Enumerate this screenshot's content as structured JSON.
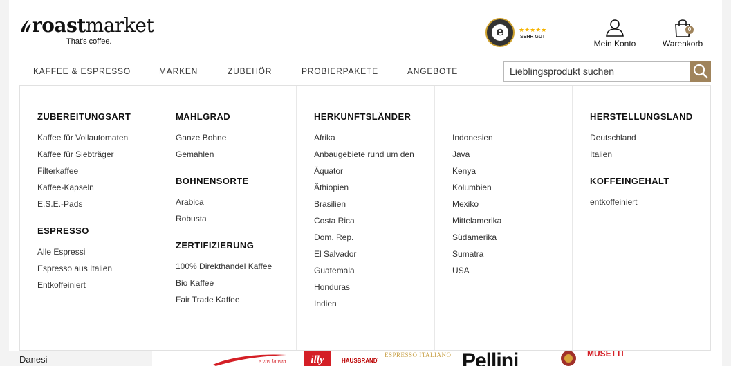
{
  "header": {
    "logo_bold": "roast",
    "logo_light": "market",
    "tagline": "That's coffee.",
    "trust_badge": {
      "stars": "★★★★★",
      "rating": "SEHR GUT",
      "seal_letter": "e",
      "icon": "trusted-shops-seal-icon"
    },
    "account_label": "Mein Konto",
    "account_icon": "user-icon",
    "cart_label": "Warenkorb",
    "cart_icon": "shopping-bag-icon",
    "cart_count": "0"
  },
  "nav": {
    "items": [
      "KAFFEE & ESPRESSO",
      "MARKEN",
      "ZUBEHÖR",
      "PROBIERPAKETE",
      "ANGEBOTE"
    ],
    "search_placeholder": "Lieblingsprodukt suchen",
    "search_icon": "search-icon"
  },
  "menu": {
    "columns": [
      {
        "sections": [
          {
            "title": "ZUBEREITUNGSART",
            "items": [
              "Kaffee für Vollautomaten",
              "Kaffee für Siebträger",
              "Filterkaffee",
              "Kaffee-Kapseln",
              "E.S.E.-Pads"
            ]
          },
          {
            "title": "ESPRESSO",
            "items": [
              "Alle Espressi",
              "Espresso aus Italien",
              "Entkoffeiniert"
            ]
          }
        ]
      },
      {
        "sections": [
          {
            "title": "MAHLGRAD",
            "items": [
              "Ganze Bohne",
              "Gemahlen"
            ]
          },
          {
            "title": "BOHNENSORTE",
            "items": [
              "Arabica",
              "Robusta"
            ]
          },
          {
            "title": "ZERTIFIZIERUNG",
            "items": [
              "100% Direkthandel Kaffee",
              "Bio Kaffee",
              "Fair Trade Kaffee"
            ]
          }
        ]
      },
      {
        "sections": [
          {
            "title": "HERKUNFTSLÄNDER",
            "items": [
              "Afrika",
              "Anbaugebiete rund um den",
              "Äquator",
              "Äthiopien",
              "Brasilien",
              "Costa Rica",
              "Dom. Rep.",
              "El Salvador",
              "Guatemala",
              "Honduras",
              "Indien"
            ]
          }
        ]
      },
      {
        "sections": [
          {
            "title": "",
            "items": [
              "Indonesien",
              "Java",
              "Kenya",
              "Kolumbien",
              "Mexiko",
              "Mittelamerika",
              "Südamerika",
              "Sumatra",
              "USA"
            ]
          }
        ]
      },
      {
        "sections": [
          {
            "title": "HERSTELLUNGSLAND",
            "items": [
              "Deutschland",
              "Italien"
            ]
          },
          {
            "title": "KOFFEINGEHALT",
            "items": [
              "entkoffeiniert"
            ]
          }
        ]
      }
    ]
  },
  "bottom": {
    "label": "Danesi",
    "brands": [
      "...e vivi la vita",
      "illy",
      "HAUSBRANDT",
      "ESPRESSO ITALIANO",
      "Pellini",
      "MUSETTI"
    ]
  },
  "colors": {
    "accent": "#a0845c",
    "text": "#333333",
    "page_bg": "#f3f3f3"
  }
}
